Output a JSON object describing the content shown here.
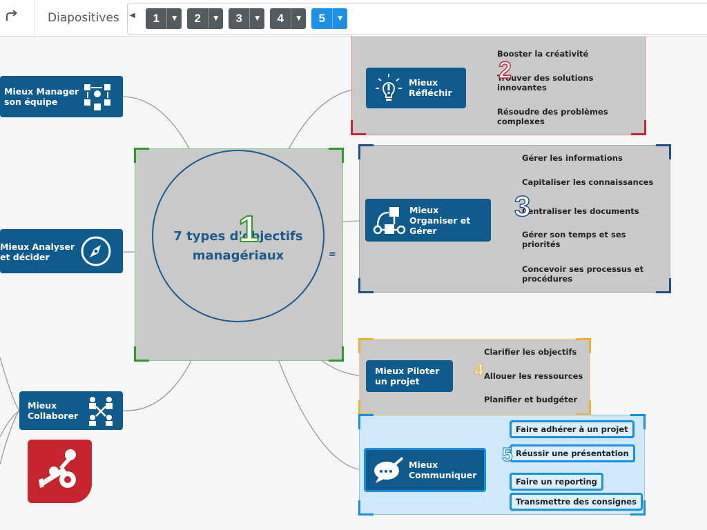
{
  "toolbar": {
    "redo_icon": "redo-icon",
    "title": "Diapositives",
    "slides": [
      {
        "number": "1",
        "active": false
      },
      {
        "number": "2",
        "active": false
      },
      {
        "number": "3",
        "active": false
      },
      {
        "number": "4",
        "active": false
      },
      {
        "number": "5",
        "active": true
      }
    ]
  },
  "mindmap": {
    "center": {
      "title": "7 types d'objectifs managériaux",
      "marker": "1",
      "menu_icon": "hamburger-icon"
    },
    "left_nodes": [
      {
        "label": "Mieux Manager son équipe",
        "icon": "team-icon"
      },
      {
        "label": "Mieux Analyser et décider",
        "icon": "compass-icon"
      },
      {
        "label": "Mieux Collaborer",
        "icon": "network-icon"
      }
    ],
    "right_nodes": [
      {
        "label": "Mieux Réfléchir",
        "icon": "lightbulb-icon",
        "marker": "2",
        "children": [
          "Booster la créativité",
          "Trouver des solutions innovantes",
          "Résoudre des problèmes complexes"
        ]
      },
      {
        "label": "Mieux Organiser et Gérer",
        "icon": "workflow-icon",
        "marker": "3",
        "children": [
          "Gérer les informations",
          "Capitaliser les connaissances",
          "Centraliser les documents",
          "Gérer son temps et ses priorités",
          "Concevoir ses processus et procédures"
        ]
      },
      {
        "label": "Mieux Piloter un projet",
        "icon": "",
        "marker": "4",
        "children": [
          "Clarifier les objectifs",
          "Allouer les ressources",
          "Planifier et budgéter"
        ]
      },
      {
        "label": "Mieux Communiquer",
        "icon": "speech-bubble-icon",
        "marker": "5",
        "children": [
          "Faire adhérer à un projet",
          "Réussir une présentation",
          "Faire un reporting",
          "Transmettre des consignes"
        ]
      }
    ],
    "logo_icon": "mindmanager-logo-icon"
  },
  "colors": {
    "node_blue": "#0f5b8e",
    "slide_active": "#1e90e6",
    "frame_center": "#2e9a2e",
    "frame_2": "#c0283a",
    "frame_3": "#1f4f86",
    "frame_4": "#f0b030",
    "frame_5": "#1a8fe0",
    "logo_red": "#c6242e"
  }
}
